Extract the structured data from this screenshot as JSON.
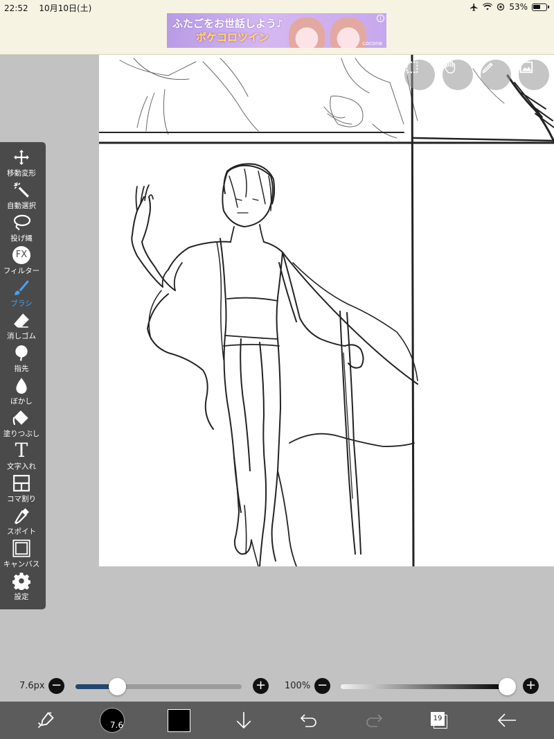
{
  "status_bar": {
    "time": "22:52",
    "date": "10月10日(土)",
    "battery": "53%"
  },
  "ad": {
    "line1": "ふたごをお世話しよう♪",
    "line2": "ポケコロツイン",
    "brand": "cocone",
    "info": "i"
  },
  "toolbar": {
    "items": [
      {
        "label": "移動変形",
        "icon": "move-icon"
      },
      {
        "label": "自動選択",
        "icon": "magic-wand-icon"
      },
      {
        "label": "投げ縄",
        "icon": "lasso-icon"
      },
      {
        "label": "フィルター",
        "icon": "fx-icon",
        "icon_text": "FX"
      },
      {
        "label": "ブラシ",
        "icon": "brush-icon",
        "active": true
      },
      {
        "label": "消しゴム",
        "icon": "eraser-icon"
      },
      {
        "label": "指先",
        "icon": "smudge-icon"
      },
      {
        "label": "ぼかし",
        "icon": "blur-icon"
      },
      {
        "label": "塗りつぶし",
        "icon": "fill-icon"
      },
      {
        "label": "文字入れ",
        "icon": "text-icon",
        "icon_text": "T"
      },
      {
        "label": "コマ割り",
        "icon": "frame-divider-icon"
      },
      {
        "label": "スポイト",
        "icon": "eyedropper-icon"
      },
      {
        "label": "キャンバス",
        "icon": "canvas-icon"
      },
      {
        "label": "設定",
        "icon": "gear-icon"
      }
    ],
    "accent_color": "#4aa0ee"
  },
  "canvas_buttons": [
    "select-icon",
    "hand-icon",
    "pen-icon",
    "image-icon"
  ],
  "brush": {
    "size_label": "7.6px",
    "size_fraction": 0.25,
    "size_color": "#23466f",
    "opacity_label": "100%",
    "opacity_fraction": 1.0,
    "minus": "−",
    "plus": "+"
  },
  "bottom_bar": {
    "brush_size_badge": "7.6",
    "color": "#000000",
    "layer_count": "19",
    "icons": [
      "transform-icon",
      "brush-preview",
      "color-swatch",
      "arrow-down-icon",
      "undo-icon",
      "redo-icon",
      "layers-icon",
      "back-arrow-icon"
    ]
  }
}
